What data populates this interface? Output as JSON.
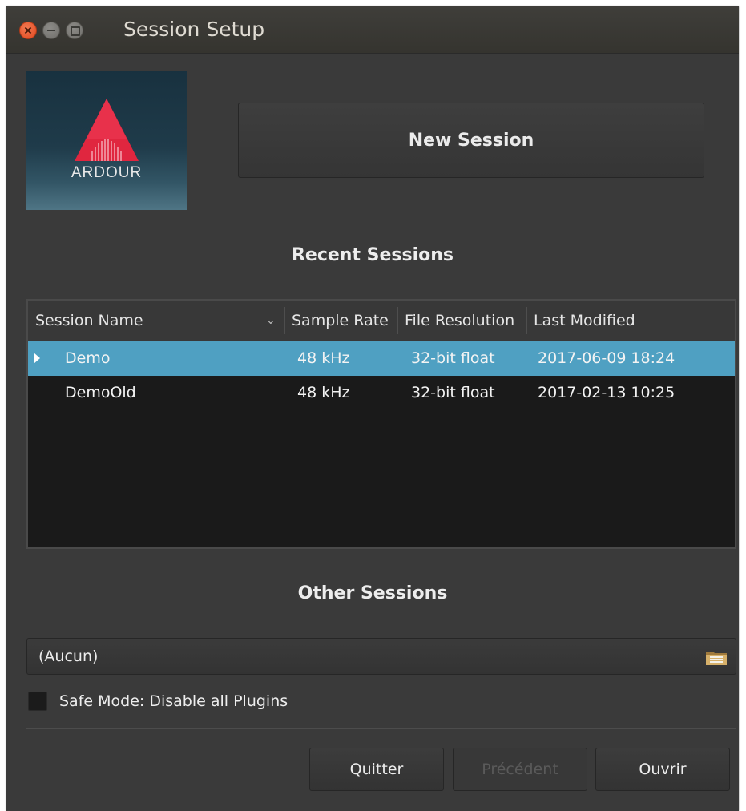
{
  "window": {
    "title": "Session Setup"
  },
  "logo": {
    "text": "ARDOUR"
  },
  "new_session_label": "New Session",
  "recent": {
    "heading": "Recent Sessions",
    "columns": [
      "Session Name",
      "Sample Rate",
      "File Resolution",
      "Last Modified"
    ],
    "rows": [
      {
        "name": "Demo",
        "sample_rate": "48 kHz",
        "resolution": "32-bit float",
        "modified": "2017-06-09 18:24",
        "selected": true,
        "expandable": true
      },
      {
        "name": "DemoOld",
        "sample_rate": "48 kHz",
        "resolution": "32-bit float",
        "modified": "2017-02-13 10:25",
        "selected": false,
        "expandable": false
      }
    ]
  },
  "other": {
    "heading": "Other Sessions",
    "file_chooser_value": "(Aucun)",
    "folder_icon": "folder-icon"
  },
  "safe_mode": {
    "label": "Safe Mode: Disable all Plugins",
    "checked": false
  },
  "buttons": {
    "quit": "Quitter",
    "previous": "Précédent",
    "open": "Ouvrir"
  },
  "colors": {
    "selection": "#4fa0c2",
    "window_bg": "#3a3a3a",
    "close_button": "#e85a2e"
  }
}
